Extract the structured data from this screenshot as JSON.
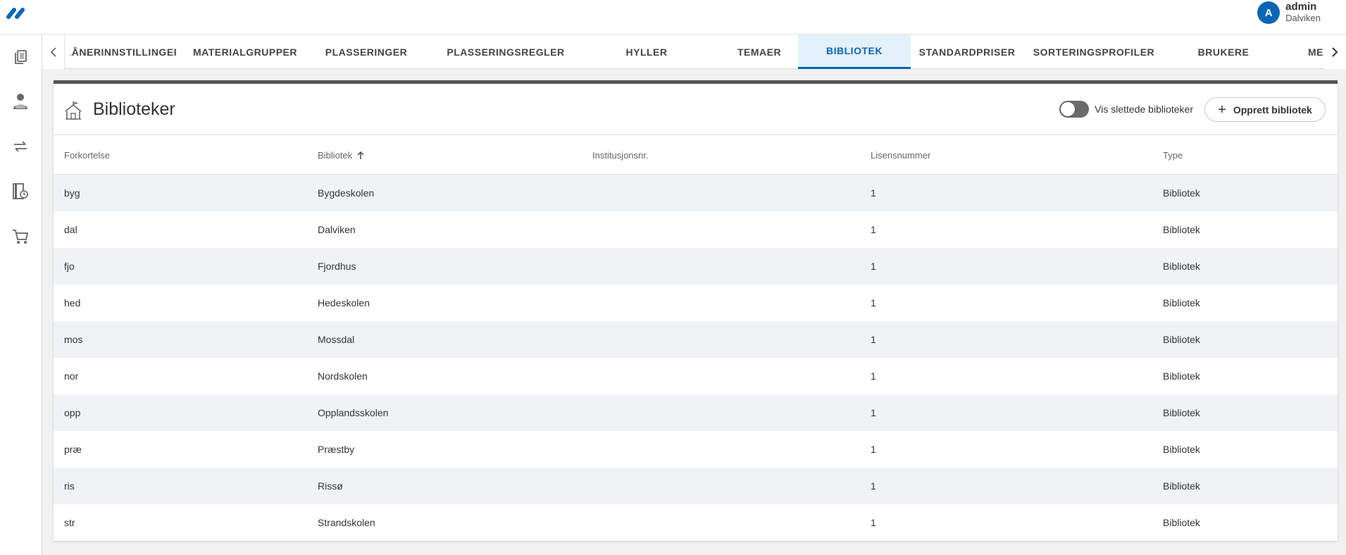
{
  "header": {
    "user_initial": "A",
    "user_name": "admin",
    "user_org": "Dalviken"
  },
  "sidebar": {
    "items": [
      {
        "icon": "documents-icon"
      },
      {
        "icon": "person-reading-icon"
      },
      {
        "icon": "swap-arrows-icon"
      },
      {
        "icon": "book-clock-icon"
      },
      {
        "icon": "cart-icon"
      }
    ]
  },
  "tabs": [
    {
      "label": "LÅNERINNSTILLINGER"
    },
    {
      "label": "MATERIALGRUPPER"
    },
    {
      "label": "PLASSERINGER"
    },
    {
      "label": "PLASSERINGSREGLER"
    },
    {
      "label": "HYLLER"
    },
    {
      "label": "TEMAER"
    },
    {
      "label": "BIBLIOTEK",
      "active": true
    },
    {
      "label": "STANDARDPRISER"
    },
    {
      "label": "SORTERINGSPROFILER"
    },
    {
      "label": "BRUKERE"
    },
    {
      "label": "ME"
    }
  ],
  "page": {
    "title": "Biblioteker",
    "toggle_label": "Vis slettede biblioteker",
    "toggle_on": false,
    "create_button": "Opprett bibliotek"
  },
  "table": {
    "columns": [
      "Forkortelse",
      "Bibliotek",
      "Institusjonsnr.",
      "Lisensnummer",
      "Type"
    ],
    "sort_column": "Bibliotek",
    "sort_direction": "ascending",
    "rows": [
      {
        "abbr": "byg",
        "name": "Bygdeskolen",
        "inst": "",
        "license": "1",
        "type": "Bibliotek"
      },
      {
        "abbr": "dal",
        "name": "Dalviken",
        "inst": "",
        "license": "1",
        "type": "Bibliotek"
      },
      {
        "abbr": "fjo",
        "name": "Fjordhus",
        "inst": "",
        "license": "1",
        "type": "Bibliotek"
      },
      {
        "abbr": "hed",
        "name": "Hedeskolen",
        "inst": "",
        "license": "1",
        "type": "Bibliotek"
      },
      {
        "abbr": "mos",
        "name": "Mossdal",
        "inst": "",
        "license": "1",
        "type": "Bibliotek"
      },
      {
        "abbr": "nor",
        "name": "Nordskolen",
        "inst": "",
        "license": "1",
        "type": "Bibliotek"
      },
      {
        "abbr": "opp",
        "name": "Opplandsskolen",
        "inst": "",
        "license": "1",
        "type": "Bibliotek"
      },
      {
        "abbr": "præ",
        "name": "Præstby",
        "inst": "",
        "license": "1",
        "type": "Bibliotek"
      },
      {
        "abbr": "ris",
        "name": "Rissø",
        "inst": "",
        "license": "1",
        "type": "Bibliotek"
      },
      {
        "abbr": "str",
        "name": "Strandskolen",
        "inst": "",
        "license": "1",
        "type": "Bibliotek"
      }
    ]
  },
  "colors": {
    "accent": "#0b66b3",
    "active_tab_bg": "#e3f1fa",
    "row_alt": "#eff3f5"
  }
}
